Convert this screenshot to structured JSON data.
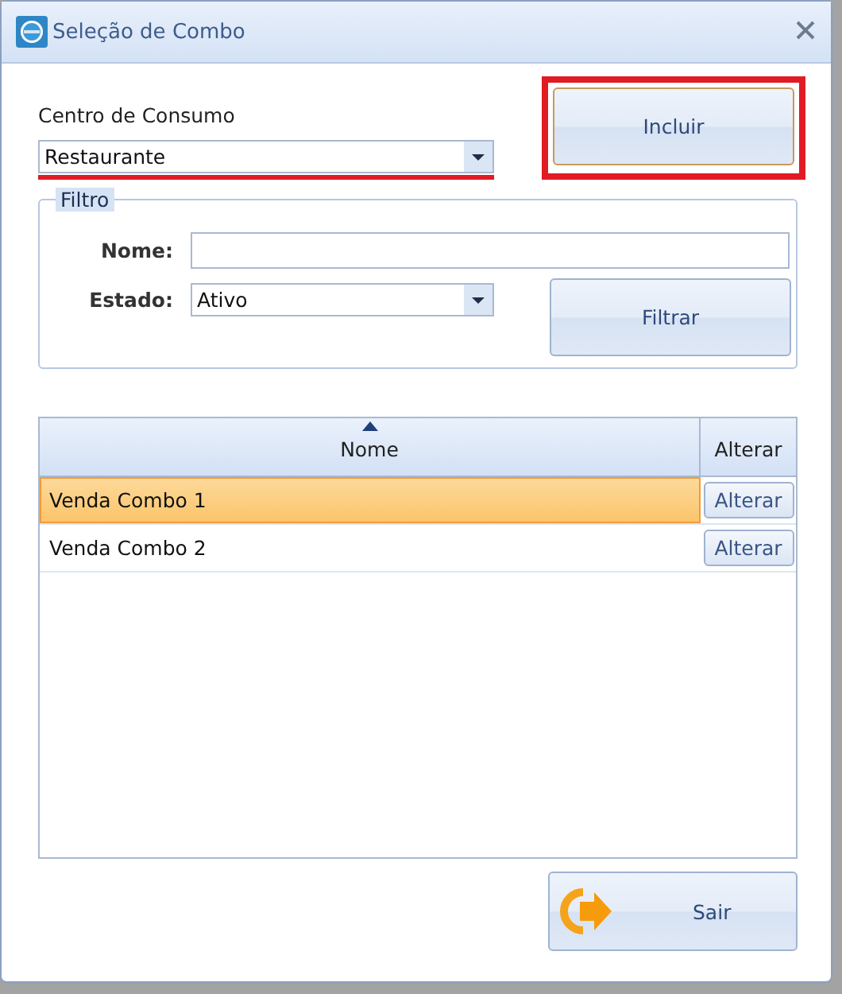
{
  "window": {
    "title": "Seleção de Combo"
  },
  "consumo": {
    "label": "Centro de Consumo",
    "value": "Restaurante",
    "highlighted": true
  },
  "incluir": {
    "label": "Incluir",
    "highlighted": true
  },
  "filtro": {
    "title": "Filtro",
    "nome_label": "Nome:",
    "estado_label": "Estado:",
    "estado_value": "Ativo",
    "button": "Filtrar"
  },
  "table": {
    "columns": [
      "Nome",
      "Alterar"
    ],
    "rows": [
      {
        "nome": "Venda Combo 1",
        "action": "Alterar",
        "selected": true
      },
      {
        "nome": "Venda Combo 2",
        "action": "Alterar",
        "selected": false
      }
    ]
  },
  "sair": {
    "label": "Sair"
  }
}
